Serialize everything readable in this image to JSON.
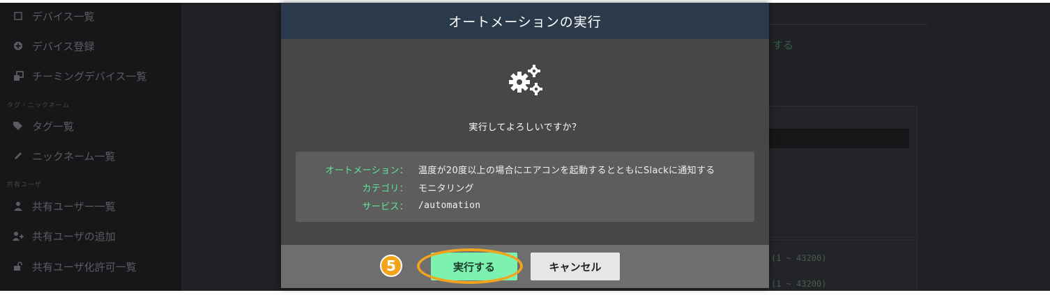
{
  "background": {
    "sidebar": {
      "items": [
        {
          "label": "デバイス一覧",
          "icon": "square-icon"
        },
        {
          "label": "デバイス登録",
          "icon": "plus-circle-icon"
        },
        {
          "label": "チーミングデバイス一覧",
          "icon": "clone-icon"
        },
        {
          "label": "タグ一覧",
          "icon": "tags-icon"
        },
        {
          "label": "ニックネーム一覧",
          "icon": "pencil-icon"
        },
        {
          "label": "共有ユーザー一覧",
          "icon": "user-icon"
        },
        {
          "label": "共有ユーザの追加",
          "icon": "user-plus-icon"
        },
        {
          "label": "共有ユーザ化許可一覧",
          "icon": "unlock-icon"
        }
      ],
      "sections": [
        "タグ・ニックネーム",
        "共有ユーザ"
      ]
    },
    "main": {
      "link_fragment": "する",
      "range_1": "(1 ~ 43200)",
      "range_2": "(1 ~ 43200)"
    }
  },
  "dialog": {
    "title": "オートメーションの実行",
    "icon": "gears-icon",
    "question": "実行してよろしいですか？",
    "details": [
      {
        "label": "オートメーション：",
        "value": "温度が20度以上の場合にエアコンを起動するとともにSlackに通知する"
      },
      {
        "label": "カテゴリ：",
        "value": "モニタリング"
      },
      {
        "label": "サービス：",
        "value": "/automation"
      }
    ],
    "buttons": {
      "execute": "実行する",
      "cancel": "キャンセル"
    },
    "step_badge": "5"
  },
  "colors": {
    "header": "#2b3a4a",
    "accent_green": "#7df2b0",
    "label_green": "#5ee79a",
    "highlight": "#f2a51c"
  }
}
